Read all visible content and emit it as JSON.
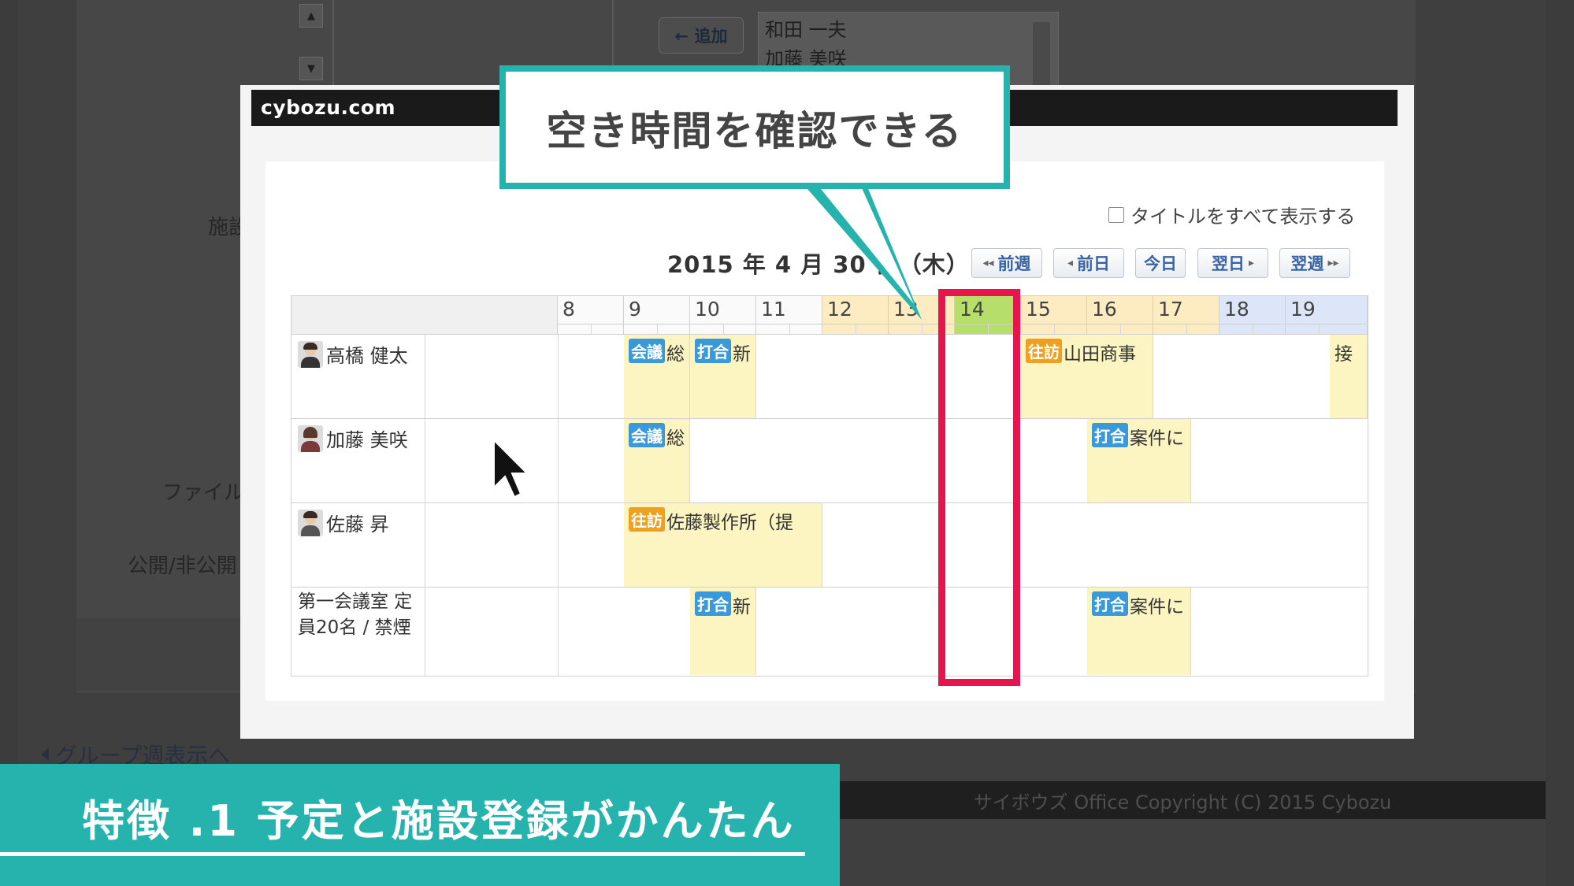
{
  "background": {
    "add_button": "← 追加",
    "members": [
      "和田 一夫",
      "加藤 美咲"
    ],
    "labels": {
      "facility": "施設",
      "file": "ファイル",
      "public": "公開/非公開"
    },
    "group_week_link": "グループ週表示へ",
    "copyright": "サイボウズ Office Copyright (C) 2015 Cybozu"
  },
  "modal": {
    "title": "cybozu.com",
    "show_all_titles": "タイトルをすべて表示する",
    "date": "2015 年 4 月 30 日（木）",
    "nav": {
      "prev_week": "前週",
      "prev_day": "前日",
      "today": "今日",
      "next_day": "翌日",
      "next_week": "翌週"
    },
    "hours": [
      "8",
      "9",
      "10",
      "11",
      "12",
      "13",
      "14",
      "15",
      "16",
      "17",
      "18",
      "19"
    ],
    "rows": [
      {
        "name": "高橋 健太"
      },
      {
        "name": "加藤 美咲"
      },
      {
        "name": "佐藤 昇"
      },
      {
        "name": "第一会議室 定員20名 / 禁煙"
      }
    ],
    "events": {
      "r0_meeting": {
        "tag": "会議",
        "text": "総"
      },
      "r0_mtg": {
        "tag": "打合",
        "text": "新"
      },
      "r0_visit": {
        "tag": "往訪",
        "text": "山田商事"
      },
      "r0_recv": {
        "text": "接"
      },
      "r1_meeting": {
        "tag": "会議",
        "text": "総"
      },
      "r1_mtg": {
        "tag": "打合",
        "text": "案件に"
      },
      "r2_visit": {
        "tag": "往訪",
        "text": "佐藤製作所（提"
      },
      "r3_mtg1": {
        "tag": "打合",
        "text": "新"
      },
      "r3_mtg2": {
        "tag": "打合",
        "text": "案件に"
      }
    }
  },
  "callout": {
    "text": "空き時間を確認できる"
  },
  "feature": {
    "text": "特徴 .1 予定と施設登録がかんたん"
  },
  "colors": {
    "teal": "#26b3ae",
    "highlight": "#e8144e",
    "event_bg": "#fcf5c2",
    "tag_blue": "#3a9ad9",
    "tag_orange": "#f0a020"
  }
}
